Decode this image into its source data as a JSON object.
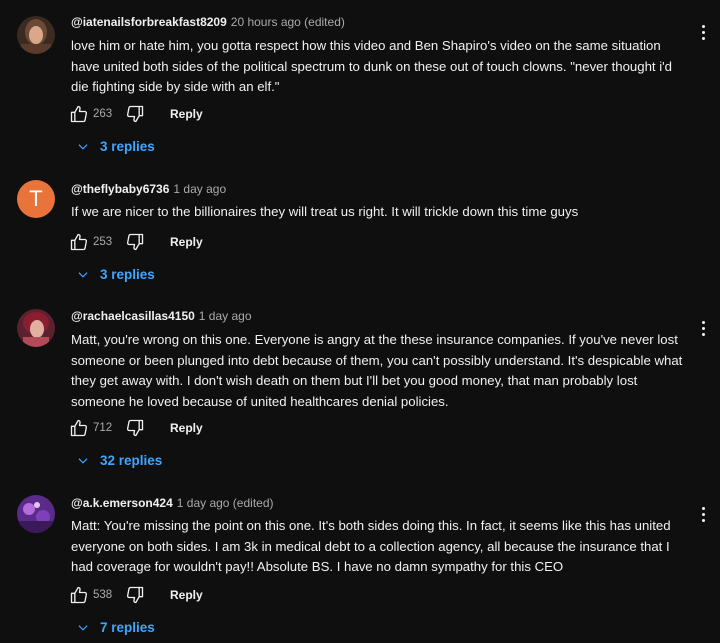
{
  "comments": [
    {
      "handle": "@iatenailsforbreakfast8209",
      "time": "20 hours ago (edited)",
      "text": "love him or hate him, you gotta respect how this video and Ben Shapiro's video on the same situation have united both sides of the political spectrum to dunk on these out of touch clowns. \"never thought i'd die fighting side by side with an elf.\"",
      "likes": "263",
      "reply_label": "Reply",
      "replies_label": "3 replies"
    },
    {
      "handle": "@theflybaby6736",
      "time": "1 day ago",
      "avatar_letter": "T",
      "text": "If we are nicer to the billionaires they will treat us right. It will trickle down this time guys",
      "likes": "253",
      "reply_label": "Reply",
      "replies_label": "3 replies"
    },
    {
      "handle": "@rachaelcasillas4150",
      "time": "1 day ago",
      "text": "Matt, you're wrong on this one. Everyone is angry at the these insurance companies. If you've never lost someone or been plunged into debt because of them, you can't possibly understand. It's despicable what they get away with. I don't wish death on them but I'll bet you good money, that man probably lost someone he loved because of united healthcares denial policies.",
      "likes": "712",
      "reply_label": "Reply",
      "replies_label": "32 replies"
    },
    {
      "handle": "@a.k.emerson424",
      "time": "1 day ago (edited)",
      "text": "Matt: You're missing the point on this one. It's both sides doing this. In fact, it seems like this has united everyone on both sides. I am 3k in medical debt to a collection agency, all because the insurance that I had coverage for wouldn't pay!! Absolute BS. I have no damn sympathy for this CEO",
      "likes": "538",
      "reply_label": "Reply",
      "replies_label": "7 replies"
    }
  ],
  "colors": {
    "background": "#0f0f0f",
    "text": "#f1f1f1",
    "muted": "#aaaaaa",
    "link": "#3ea6ff",
    "avatar_t": "#e8743b"
  },
  "icons": [
    "thumbs-up-icon",
    "thumbs-down-icon",
    "chevron-down-icon",
    "more-vert-icon"
  ]
}
